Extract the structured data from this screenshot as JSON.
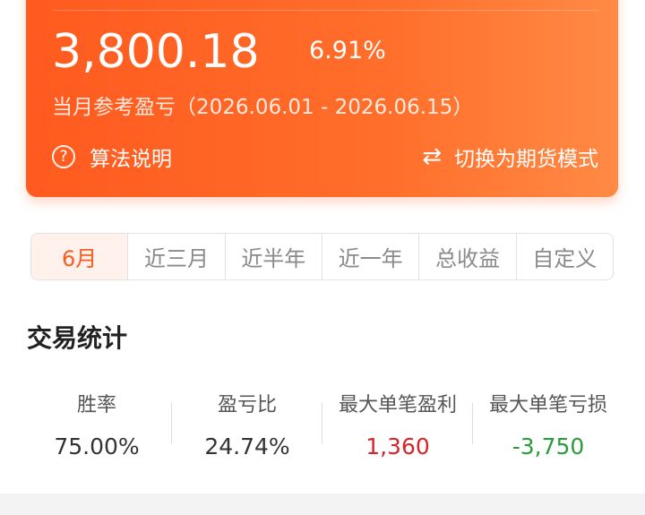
{
  "summary": {
    "amount": "3,800.18",
    "percent": "6.91%",
    "period_label": "当月参考盈亏",
    "period_range": "（2026.06.01 - 2026.06.15）",
    "help_label": "算法说明",
    "switch_label": "切换为期货模式"
  },
  "tabs": [
    {
      "label": "6月",
      "active": true
    },
    {
      "label": "近三月"
    },
    {
      "label": "近半年"
    },
    {
      "label": "近一年"
    },
    {
      "label": "总收益"
    },
    {
      "label": "自定义"
    }
  ],
  "stats": {
    "title": "交易统计",
    "items": [
      {
        "label": "胜率",
        "value": "75.00%"
      },
      {
        "label": "盈亏比",
        "value": "24.74%"
      },
      {
        "label": "最大单笔盈利",
        "value": "1,360"
      },
      {
        "label": "最大单笔亏损",
        "value": "-3,750"
      }
    ]
  },
  "colors": {
    "accent": "#ff5a1f",
    "profit": "#d6242a",
    "loss": "#2a9c3b"
  }
}
